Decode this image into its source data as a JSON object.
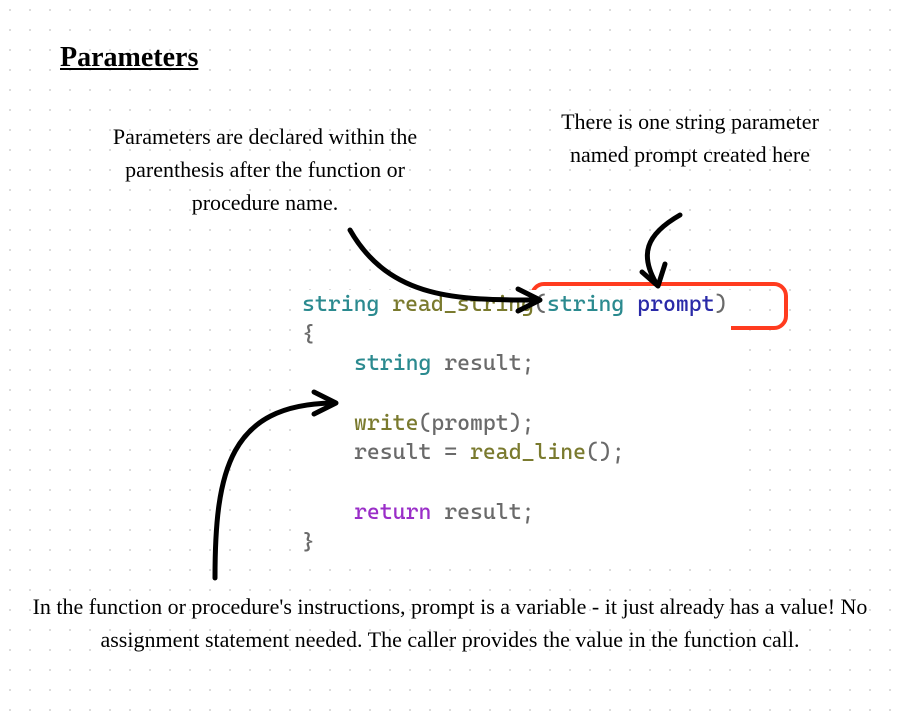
{
  "heading": "Parameters",
  "annotations": {
    "a1": "Parameters are declared within the parenthesis after the function or procedure name.",
    "a2": "There is one string parameter named prompt created here",
    "a3": "In the function or procedure's instructions, prompt is a variable - it just already has a value! No assignment statement needed. The caller provides the value in the function call."
  },
  "code": {
    "t_string1": "string",
    "fn_name": "read_string",
    "open_paren": "(",
    "t_string2": "string",
    "param": "prompt",
    "close_paren": ")",
    "brace_open": "{",
    "decl_type": "string",
    "decl_name": " result;",
    "write_call": "write",
    "write_arg": "(prompt);",
    "assign": "result = ",
    "readline": "read_line",
    "readline_tail": "();",
    "ret_kw": "return",
    "ret_val": " result;",
    "brace_close": "}"
  }
}
